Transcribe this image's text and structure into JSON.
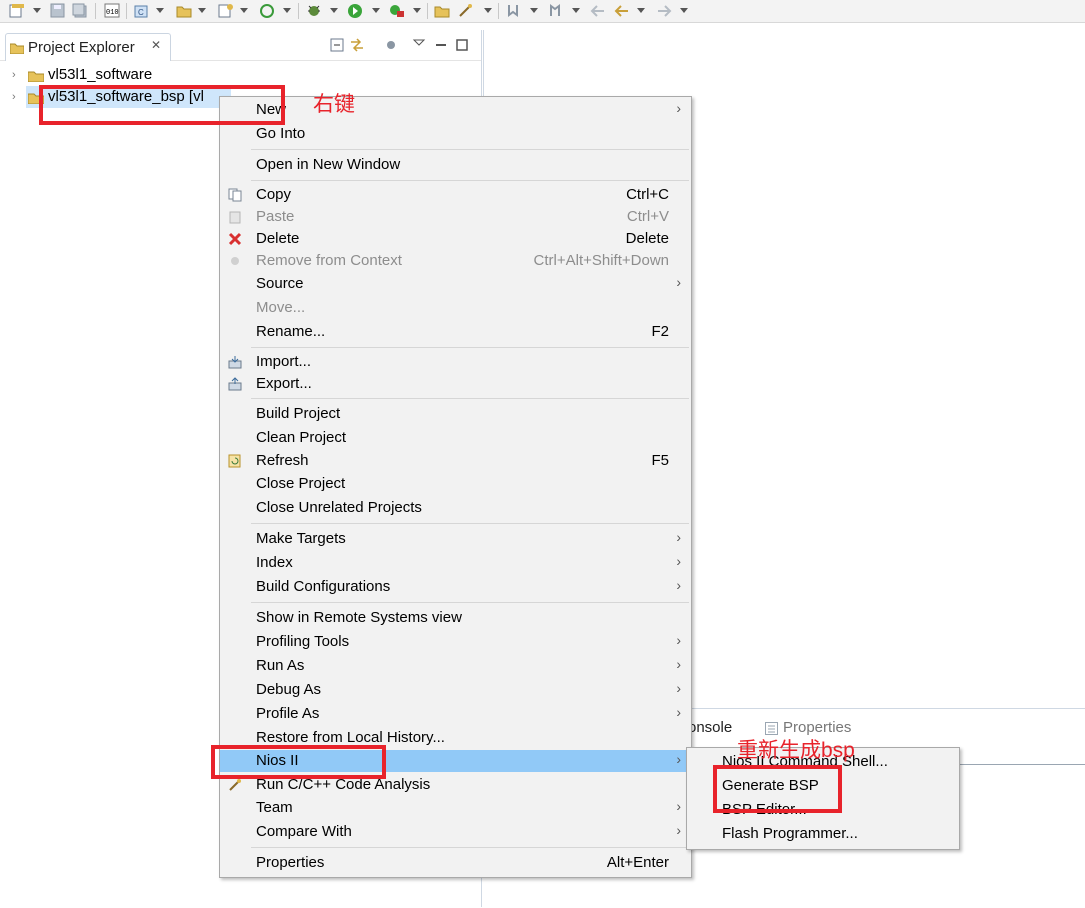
{
  "toolbar": {
    "icons": [
      "new-icon",
      "save-icon",
      "save-all-icon",
      "binary-icon",
      "c-file-icon",
      "folder-icon",
      "new-wizard-icon",
      "refresh-icon",
      "debug-icon",
      "run-icon",
      "external-tools-icon",
      "open-folder-icon",
      "wand-icon",
      "next-annotation-icon",
      "prev-annotation-icon",
      "back-icon",
      "back-history-icon",
      "forward-icon"
    ]
  },
  "explorer": {
    "tab_label": "Project Explorer",
    "tab_close": "✕",
    "tree": [
      {
        "label": "vl53l1_software",
        "expander": "›"
      },
      {
        "label": "vl53l1_software_bsp [vl",
        "expander": "›"
      }
    ]
  },
  "lower_panel": {
    "console_tab": "onsole",
    "properties_tab": "Properties"
  },
  "context_menu": {
    "items": [
      {
        "label": "New",
        "submenu": "›"
      },
      {
        "label": "Go Into"
      },
      {
        "label": "Open in New Window"
      },
      {
        "label": "Copy",
        "shortcut": "Ctrl+C",
        "icon": "copy-icon"
      },
      {
        "label": "Paste",
        "shortcut": "Ctrl+V",
        "icon": "paste-icon",
        "disabled": true
      },
      {
        "label": "Delete",
        "shortcut": "Delete",
        "icon": "delete-icon"
      },
      {
        "label": "Remove from Context",
        "shortcut": "Ctrl+Alt+Shift+Down",
        "icon": "remove-context-icon",
        "disabled": true
      },
      {
        "label": "Source",
        "submenu": "›"
      },
      {
        "label": "Move...",
        "disabled": true
      },
      {
        "label": "Rename...",
        "shortcut": "F2"
      },
      {
        "label": "Import...",
        "icon": "import-icon"
      },
      {
        "label": "Export...",
        "icon": "export-icon"
      },
      {
        "label": "Build Project"
      },
      {
        "label": "Clean Project"
      },
      {
        "label": "Refresh",
        "shortcut": "F5",
        "icon": "refresh-icon"
      },
      {
        "label": "Close Project"
      },
      {
        "label": "Close Unrelated Projects"
      },
      {
        "label": "Make Targets",
        "submenu": "›"
      },
      {
        "label": "Index",
        "submenu": "›"
      },
      {
        "label": "Build Configurations",
        "submenu": "›"
      },
      {
        "label": "Show in Remote Systems view"
      },
      {
        "label": "Profiling Tools",
        "submenu": "›"
      },
      {
        "label": "Run As",
        "submenu": "›"
      },
      {
        "label": "Debug As",
        "submenu": "›"
      },
      {
        "label": "Profile As",
        "submenu": "›"
      },
      {
        "label": "Restore from Local History..."
      },
      {
        "label": "Nios II",
        "submenu": "›",
        "highlighted": true
      },
      {
        "label": "Run C/C++ Code Analysis",
        "icon": "code-analysis-icon"
      },
      {
        "label": "Team",
        "submenu": "›"
      },
      {
        "label": "Compare With",
        "submenu": "›"
      },
      {
        "label": "Properties",
        "shortcut": "Alt+Enter"
      }
    ]
  },
  "nios_submenu": {
    "items": [
      {
        "label": "Nios II Command Shell..."
      },
      {
        "label": "Generate BSP"
      },
      {
        "label": "BSP Editor..."
      },
      {
        "label": "Flash Programmer..."
      }
    ]
  },
  "annotations": {
    "right_click_note": "右键",
    "regenerate_note": "重新生成bsp",
    "color": "#e8232b"
  },
  "colors": {
    "highlight": "#91c9f7",
    "selection": "#cfe6fb",
    "menu_bg": "#f2f2f2"
  }
}
